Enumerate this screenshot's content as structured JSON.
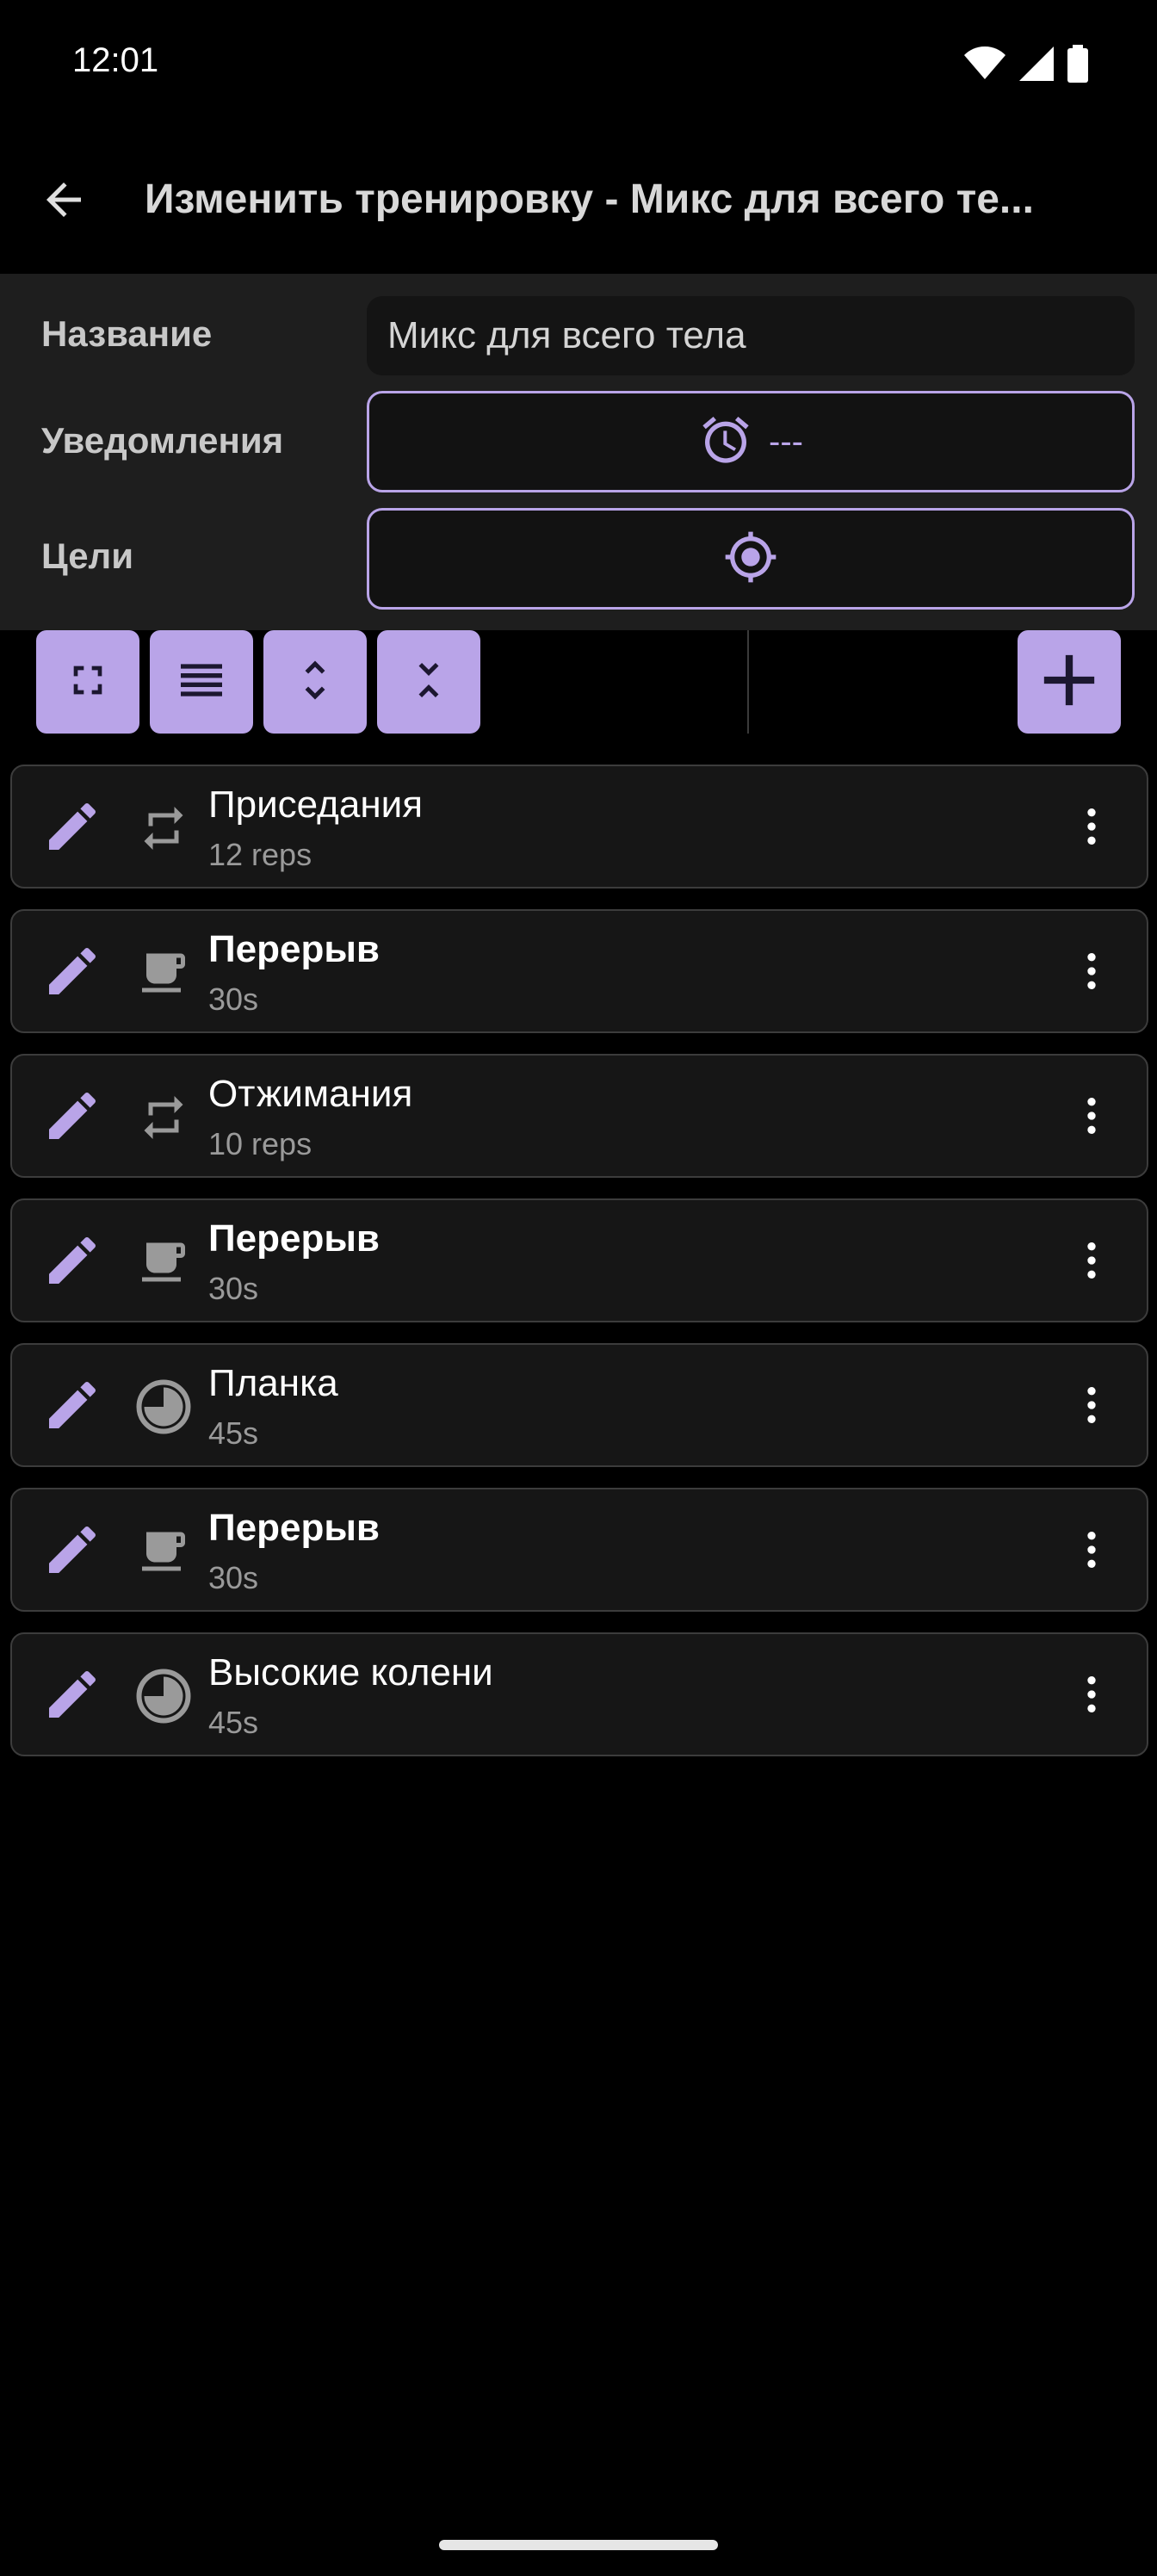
{
  "status_bar": {
    "time": "12:01"
  },
  "app_bar": {
    "title": "Изменить тренировку - Микс для всего те..."
  },
  "form": {
    "name_label": "Название",
    "name_value": "Микс для всего тела",
    "reminders_label": "Уведомления",
    "reminders_value": "---",
    "goals_label": "Цели"
  },
  "colors": {
    "accent": "#b9a4e8",
    "background": "#000000",
    "panel": "#1e1e1e",
    "item_bg": "#161616",
    "item_border": "#3c3c3c"
  },
  "toolbar": {
    "buttons": [
      "fullscreen-icon",
      "list-icon",
      "expand-icon",
      "collapse-icon"
    ],
    "add_icon": "plus-icon"
  },
  "exercises": [
    {
      "name": "Приседания",
      "detail": "12 reps",
      "icon": "repeat-icon",
      "bold": false
    },
    {
      "name": "Перерыв",
      "detail": "30s",
      "icon": "coffee-cup-icon",
      "bold": true
    },
    {
      "name": "Отжимания",
      "detail": "10 reps",
      "icon": "repeat-icon",
      "bold": false
    },
    {
      "name": "Перерыв",
      "detail": "30s",
      "icon": "coffee-cup-icon",
      "bold": true
    },
    {
      "name": "Планка",
      "detail": "45s",
      "icon": "timer-pie-icon",
      "bold": false
    },
    {
      "name": "Перерыв",
      "detail": "30s",
      "icon": "coffee-cup-icon",
      "bold": true
    },
    {
      "name": "Высокие колени",
      "detail": "45s",
      "icon": "timer-pie-icon",
      "bold": false
    }
  ]
}
